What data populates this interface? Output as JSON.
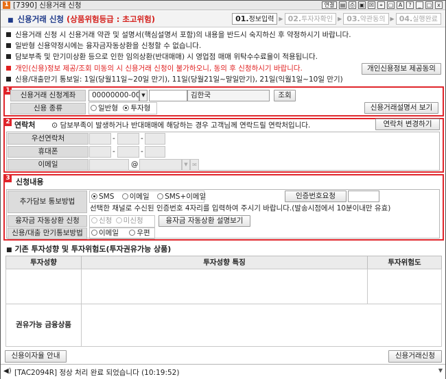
{
  "window": {
    "app_num": "1",
    "title": "[7390] 신용거래 신청",
    "title_buttons": [
      "연결",
      "",
      "",
      "",
      "",
      "",
      "",
      "A",
      "?",
      "",
      "□",
      "x"
    ]
  },
  "header": {
    "title": "신용거래 신청",
    "risk": "(상품위험등급 : 초고위험)",
    "steps": [
      {
        "num": "01.",
        "label": "정보입력",
        "active": true
      },
      {
        "num": "02.",
        "label": "투자자확인",
        "active": false
      },
      {
        "num": "03.",
        "label": "약관동의",
        "active": false
      },
      {
        "num": "04.",
        "label": "실행완료",
        "active": false
      }
    ]
  },
  "notices": [
    {
      "text": "신용거래 신청 시 신용거래 약관 및 설명서(핵심설명서 포함)의 내용을 반드시 숙지하신 후 약정하시기 바랍니다.",
      "red": false
    },
    {
      "text": "일반형 신용약정시에는 융자금자동상환을 신청할 수 없습니다.",
      "red": false
    },
    {
      "text": "담보부족 및 만기미상환 등으로 인한 임의상환(반대매매) 시 영업점 매매 위탁수수료율이 적용됩니다.",
      "red": false
    },
    {
      "text": "개인(신용)정보 제공/조회 미동의 시 신용거래 신청이 불가하오니, 동의 후 신청하시기 바랍니다.",
      "red": true
    },
    {
      "text": "신용/대출만기 통보일: 1일(당월11일~20일 만기), 11일(당월21일~말일만기), 21일(익월1일~10일 만기)",
      "red": false
    }
  ],
  "consent_button": "개인신용정보 제공동의",
  "section1": {
    "badge": "1",
    "account_label": "신용거래 신청계좌",
    "account_value": "00000000-00",
    "account_password": "",
    "account_name": "김한국",
    "query_button": "조회",
    "type_label": "신용 종류",
    "type_options": [
      {
        "label": "일반형",
        "selected": false
      },
      {
        "label": "투자형",
        "selected": true
      }
    ],
    "manual_button": "신용거래설명서 보기"
  },
  "section2": {
    "badge": "2",
    "title": "연락처",
    "desc": "담보부족이 발생하거나 반대매매에 해당하는 경우 고객님께 연락드릴 연락처입니다.",
    "change_button": "연락처 변경하기",
    "phone_label": "우선연락처",
    "mobile_label": "휴대폰",
    "email_label": "이메일",
    "sep": "-",
    "at": "@"
  },
  "section3": {
    "badge": "3",
    "title": "신청내용",
    "notify_label": "추가담보 통보방법",
    "notify_options": [
      {
        "label": "SMS",
        "selected": true
      },
      {
        "label": "이메일",
        "selected": false
      },
      {
        "label": "SMS+이메일",
        "selected": false
      }
    ],
    "auth_button": "인증번호요청",
    "auth_desc": "선택한 채널로 수신된 인증번호 4자리를 입력하여 주시기 바랍니다.(발송시점에서 10분이내만 유효)",
    "repay_label": "융자금 자동상환 신청",
    "repay_options": [
      {
        "label": "신청",
        "selected": false
      },
      {
        "label": "미신청",
        "selected": false
      }
    ],
    "repay_button": "융자금 자동상환 설명보기",
    "expiry_label": "신용/대출 만기통보방법",
    "expiry_options": [
      {
        "label": "이메일",
        "selected": false
      },
      {
        "label": "우편",
        "selected": false
      }
    ]
  },
  "investor": {
    "title": "기존 투자성향 및 투자위험도(투자권유가능 상품)",
    "col_profile": "투자성향",
    "col_feature": "투자성향 특징",
    "col_risk": "투자위험도",
    "recommend_label": "권유가능 금융상품"
  },
  "bottom": {
    "info_button": "신용이자율 안내",
    "apply_button": "신용거래신청"
  },
  "status": {
    "message": "[TAC2094R] 정상 처리 완료 되었습니다 (10:19:52)"
  }
}
